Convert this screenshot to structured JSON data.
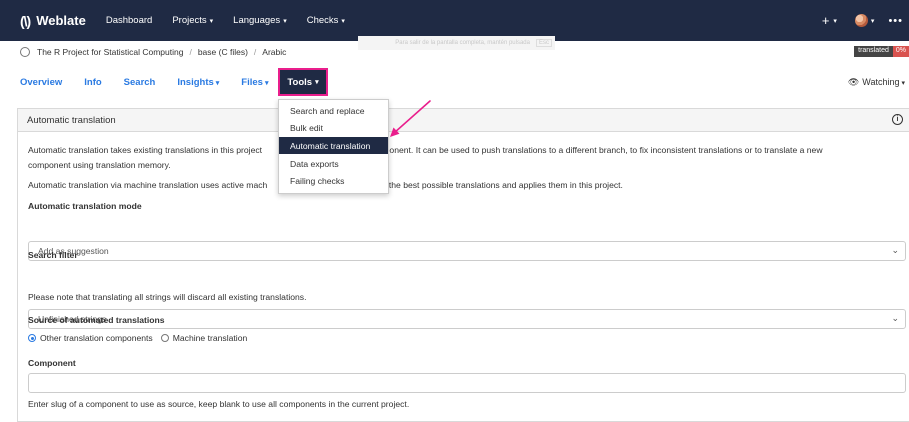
{
  "navbar": {
    "brand": "Weblate",
    "links": [
      {
        "label": "Dashboard",
        "caret": false
      },
      {
        "label": "Projects",
        "caret": true
      },
      {
        "label": "Languages",
        "caret": true
      },
      {
        "label": "Checks",
        "caret": true
      }
    ],
    "plus": "+",
    "caret": "▾",
    "more": "•••"
  },
  "breadcrumb": {
    "project": "The R Project for Statistical Computing",
    "component": "base (C files)",
    "language": "Arabic",
    "separator": "/"
  },
  "hint": {
    "text": "Para salir de la pantalla completa, mantén pulsada",
    "key": "Esc"
  },
  "badge": {
    "label": "translated",
    "value": "0%"
  },
  "tabs": [
    {
      "label": "Overview",
      "caret": false
    },
    {
      "label": "Info",
      "caret": false
    },
    {
      "label": "Search",
      "caret": false
    },
    {
      "label": "Insights",
      "caret": true
    },
    {
      "label": "Files",
      "caret": true
    }
  ],
  "tools_tab": {
    "label": "Tools",
    "highlight_color": "#e91e8c"
  },
  "watching": {
    "label": "Watching",
    "icon": "eye-icon"
  },
  "panel": {
    "title": "Automatic translation",
    "info_icon": "i",
    "para1_line1": "Automatic translation takes existing translations in this project",
    "para1_line1b": "ent component. It can be used to push translations to a different branch, to fix inconsistent translations or to translate a new",
    "para1_line2": "component using translation memory.",
    "para2_start": "Automatic translation via machine translation uses active mach",
    "para2_end": "et the best possible translations and applies them in this project.",
    "mode_label": "Automatic translation mode",
    "mode_value": "Add as suggestion",
    "filter_label": "Search filter",
    "filter_value": "Unfinished strings",
    "filter_note": "Please note that translating all strings will discard all existing translations.",
    "source_label": "Source of automated translations",
    "source_options": [
      "Other translation components",
      "Machine translation"
    ],
    "component_label": "Component",
    "component_value": "",
    "component_help": "Enter slug of a component to use as source, keep blank to use all components in the current project."
  },
  "dropdown": {
    "items": [
      {
        "label": "Search and replace",
        "active": false
      },
      {
        "label": "Bulk edit",
        "active": false
      },
      {
        "label": "Automatic translation",
        "active": true
      },
      {
        "label": "Data exports",
        "active": false
      },
      {
        "label": "Failing checks",
        "active": false
      }
    ]
  },
  "colors": {
    "navbar": "#1f2a44",
    "link": "#2a7ae2",
    "annotation": "#e91e8c"
  }
}
